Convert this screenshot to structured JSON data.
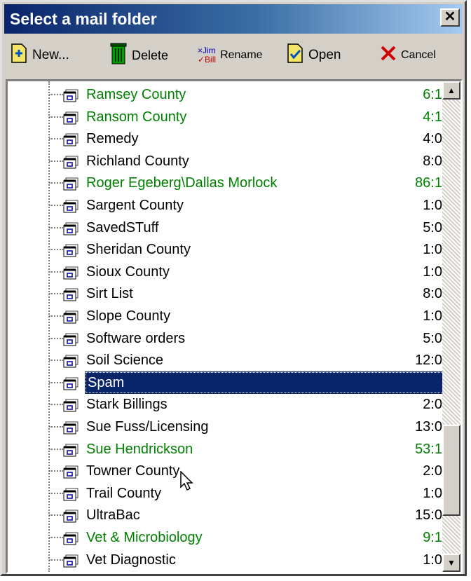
{
  "window": {
    "title": "Select a mail folder"
  },
  "toolbar": {
    "new_label": "New...",
    "delete_label": "Delete",
    "rename_label": "Rename",
    "rename_icon_top": "×Jim",
    "rename_icon_bottom": "✓Bill",
    "open_label": "Open",
    "cancel_label": "Cancel"
  },
  "colors": {
    "title_gradient_start": "#0a246a",
    "title_gradient_end": "#a6caf0",
    "unread_folder_text": "#008000",
    "selection_bg": "#0a246a"
  },
  "folders": [
    {
      "name": "Ramsey County",
      "count": "6:1",
      "unread": true
    },
    {
      "name": "Ransom County",
      "count": "4:1",
      "unread": true
    },
    {
      "name": "Remedy",
      "count": "4:0",
      "unread": false
    },
    {
      "name": "Richland County",
      "count": "8:0",
      "unread": false
    },
    {
      "name": "Roger Egeberg\\Dallas Morlock",
      "count": "86:1",
      "unread": true
    },
    {
      "name": "Sargent County",
      "count": "1:0",
      "unread": false
    },
    {
      "name": "SavedSTuff",
      "count": "5:0",
      "unread": false
    },
    {
      "name": "Sheridan County",
      "count": "1:0",
      "unread": false
    },
    {
      "name": "Sioux County",
      "count": "1:0",
      "unread": false
    },
    {
      "name": "Sirt List",
      "count": "8:0",
      "unread": false
    },
    {
      "name": "Slope County",
      "count": "1:0",
      "unread": false
    },
    {
      "name": "Software orders",
      "count": "5:0",
      "unread": false
    },
    {
      "name": "Soil Science",
      "count": "12:0",
      "unread": false
    },
    {
      "name": "Spam",
      "count": "",
      "unread": false,
      "selected": true
    },
    {
      "name": "Stark Billings",
      "count": "2:0",
      "unread": false
    },
    {
      "name": "Sue Fuss/Licensing",
      "count": "13:0",
      "unread": false
    },
    {
      "name": "Sue Hendrickson",
      "count": "53:1",
      "unread": true
    },
    {
      "name": "Towner County",
      "count": "2:0",
      "unread": false
    },
    {
      "name": "Trail County",
      "count": "1:0",
      "unread": false
    },
    {
      "name": "UltraBac",
      "count": "15:0",
      "unread": false
    },
    {
      "name": "Vet & Microbiology",
      "count": "9:1",
      "unread": true
    },
    {
      "name": "Vet Diagnostic",
      "count": "1:0",
      "unread": false
    }
  ]
}
